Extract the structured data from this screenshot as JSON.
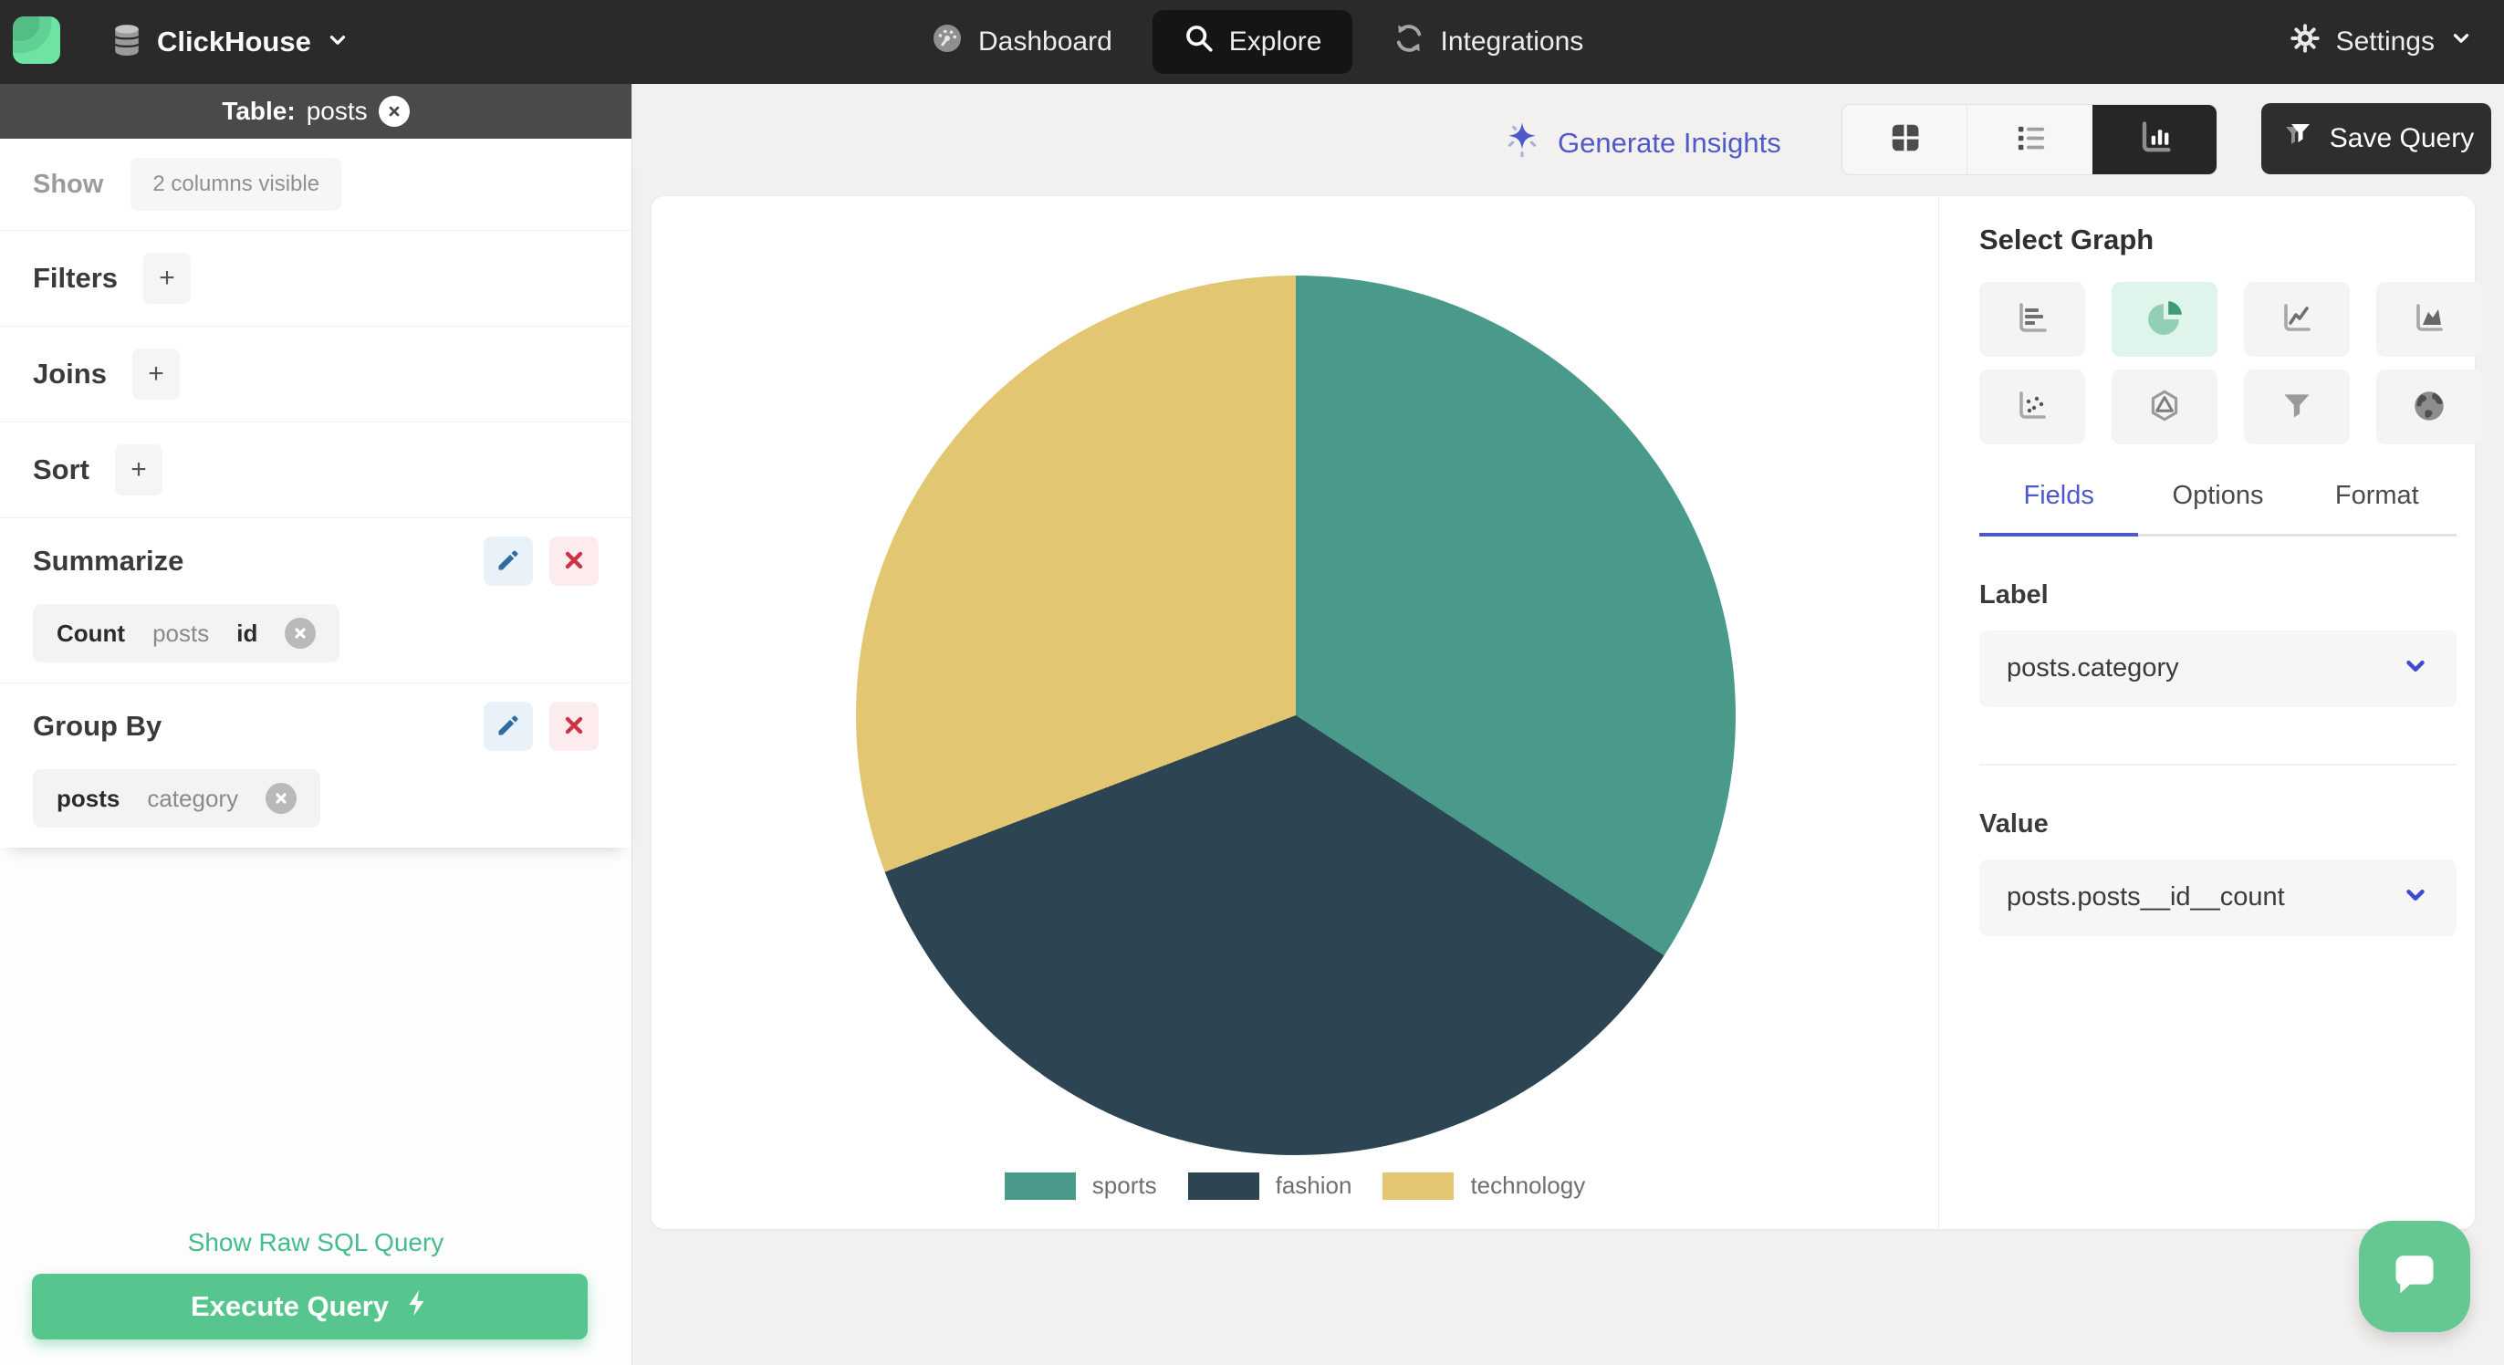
{
  "navbar": {
    "brand": "ClickHouse",
    "items": [
      {
        "label": "Dashboard",
        "icon": "gauge-icon"
      },
      {
        "label": "Explore",
        "icon": "search-icon",
        "active": true
      },
      {
        "label": "Integrations",
        "icon": "sync-icon"
      }
    ],
    "settings_label": "Settings"
  },
  "sidebar": {
    "table_header": {
      "prefix": "Table:",
      "table_name": "posts"
    },
    "show": {
      "label": "Show",
      "chip": "2 columns visible"
    },
    "sections": [
      {
        "label": "Filters",
        "add_label": "+"
      },
      {
        "label": "Joins",
        "add_label": "+"
      },
      {
        "label": "Sort",
        "add_label": "+"
      }
    ],
    "summarize": {
      "label": "Summarize",
      "chip": {
        "agg": "Count",
        "table": "posts",
        "column": "id"
      }
    },
    "group_by": {
      "label": "Group By",
      "chip": {
        "table": "posts",
        "column": "category"
      }
    },
    "raw_sql_link": "Show Raw SQL Query",
    "execute_button": "Execute Query"
  },
  "toolbar": {
    "generate_insights": "Generate Insights",
    "view_toggles": [
      {
        "name": "table-view-icon"
      },
      {
        "name": "list-view-icon"
      },
      {
        "name": "chart-view-icon",
        "active": true
      }
    ],
    "save_query": "Save Query"
  },
  "graph_panel": {
    "title": "Select Graph",
    "graph_types": [
      {
        "name": "bar-chart-icon"
      },
      {
        "name": "pie-chart-icon",
        "active": true
      },
      {
        "name": "line-chart-icon"
      },
      {
        "name": "area-chart-icon"
      },
      {
        "name": "scatter-plot-icon"
      },
      {
        "name": "radar-chart-icon"
      },
      {
        "name": "funnel-chart-icon"
      },
      {
        "name": "map-chart-icon"
      }
    ],
    "tabs": [
      {
        "label": "Fields",
        "active": true
      },
      {
        "label": "Options"
      },
      {
        "label": "Format"
      }
    ],
    "label_field": {
      "label": "Label",
      "value": "posts.category"
    },
    "value_field": {
      "label": "Value",
      "value": "posts.posts__id__count"
    }
  },
  "chart_data": {
    "type": "pie",
    "labels": [
      "sports",
      "fashion",
      "technology"
    ],
    "values": [
      34.2,
      35.0,
      30.8
    ],
    "colors": [
      "#4a9a8c",
      "#2d4552",
      "#e3c671"
    ],
    "start_angle_deg": 0,
    "legend_position": "bottom",
    "title": "",
    "note": "values are percentages estimated from slice angles (~123°, ~126°, ~111°)"
  },
  "colors": {
    "nav_background": "#2a2a2a",
    "accent_green": "#57c68e",
    "link_green": "#45bd8b",
    "accent_indigo": "#4f5ac8",
    "active_tile_mint": "#dff4eb",
    "edit_blue": "#2e6da4",
    "delete_red": "#cc3344",
    "logo_green": "#6fe3a3",
    "chat_green": "#65c892"
  }
}
